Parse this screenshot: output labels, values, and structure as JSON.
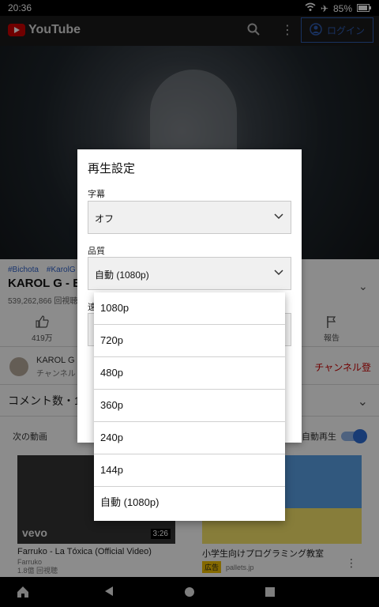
{
  "status_bar": {
    "time": "20:36",
    "battery": "85%"
  },
  "app_bar": {
    "brand": "YouTube",
    "login_label": "ログイン"
  },
  "video_meta": {
    "hashtags": [
      "#Bichota",
      "#KarolG"
    ],
    "title": "KAROL G - BIC",
    "views": "539,262,866 回視聴",
    "like_count": "419万",
    "report_label": "報告"
  },
  "channel": {
    "name": "KAROL G",
    "sub": "チャンネル",
    "subscribe_label": "チャンネル登"
  },
  "comments": {
    "label": "コメント数・1"
  },
  "upnext": {
    "label": "次の動画",
    "autoplay_label": "自動再生"
  },
  "video1": {
    "title": "Farruko - La Tóxica (Official Video)",
    "channel": "Farruko",
    "views": "1.8億 回視聴",
    "duration": "3:26",
    "overlay": "vevo"
  },
  "video2": {
    "title": "小学生向けプログラミング教室",
    "ad_badge": "広告",
    "site": "pallets.jp"
  },
  "dialog": {
    "title": "再生設定",
    "captions_label": "字幕",
    "captions_value": "オフ",
    "quality_label": "品質",
    "quality_value": "自動 (1080p)",
    "speed_label": "速"
  },
  "quality_options": [
    "1080p",
    "720p",
    "480p",
    "360p",
    "240p",
    "144p",
    "自動 (1080p)"
  ]
}
